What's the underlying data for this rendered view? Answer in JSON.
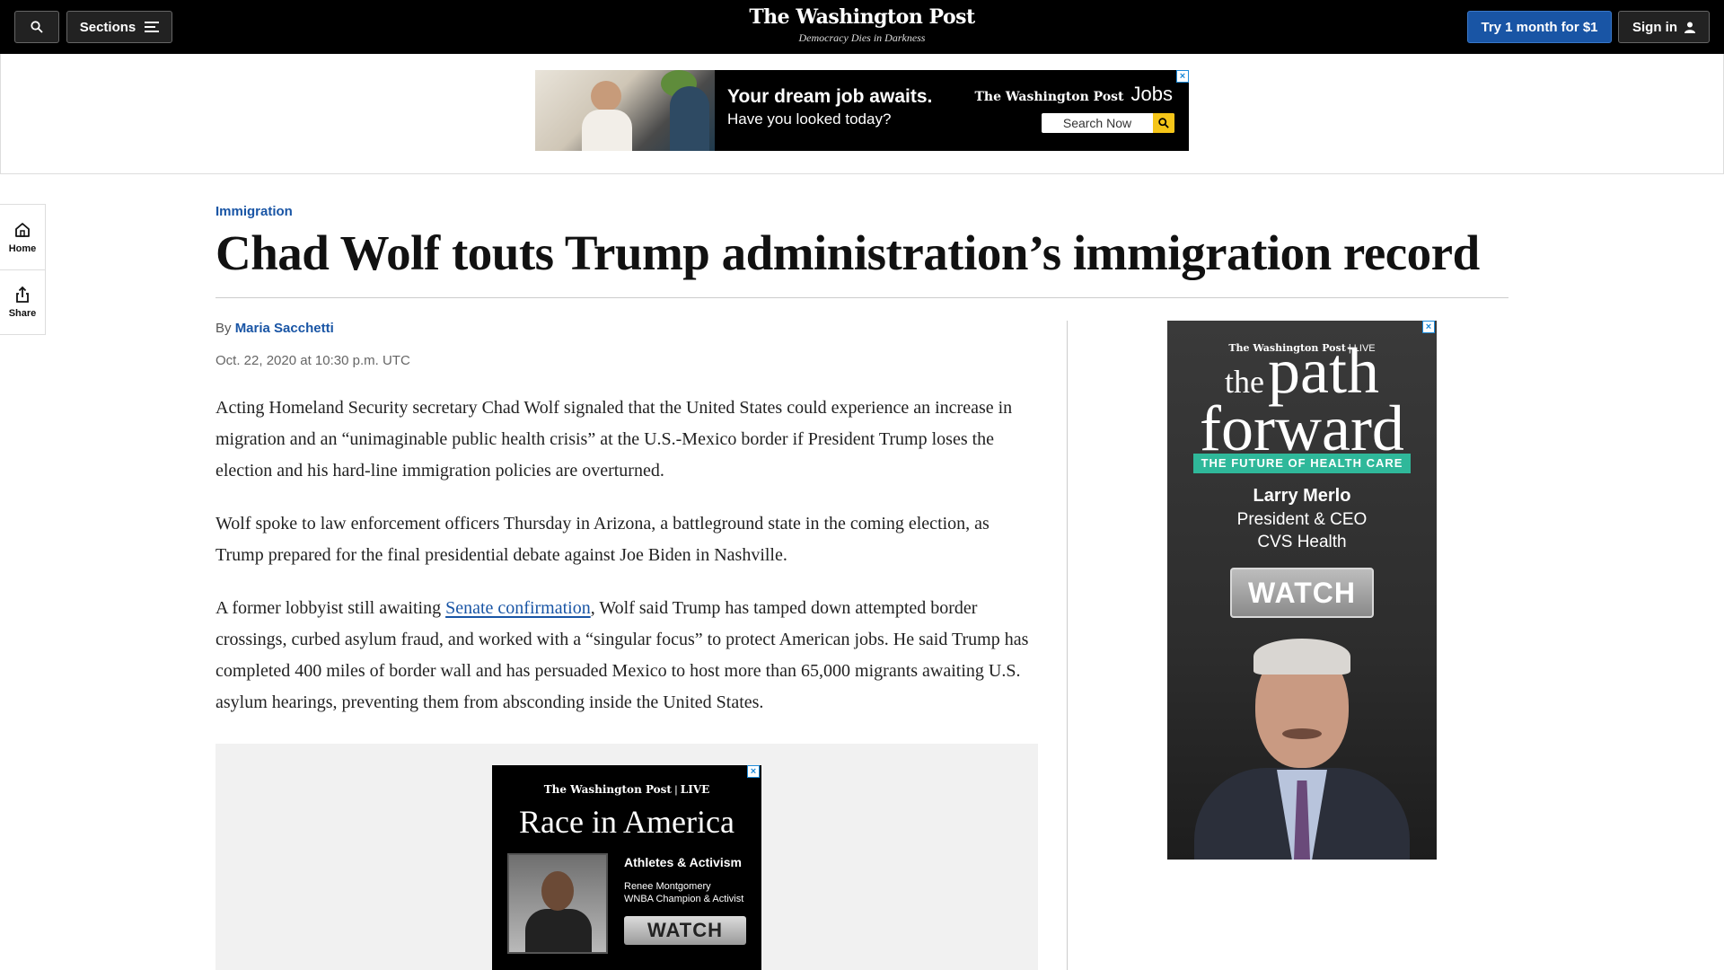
{
  "nav": {
    "sections_label": "Sections",
    "masthead": "The Washington Post",
    "tagline": "Democracy Dies in Darkness",
    "try_label": "Try 1 month for $1",
    "signin_label": "Sign in"
  },
  "top_ad": {
    "headline": "Your dream job awaits.",
    "subline": "Have you looked today?",
    "brand_logo": "The Washington Post",
    "brand_word": "Jobs",
    "search_label": "Search Now"
  },
  "left_rail": {
    "home_label": "Home",
    "share_label": "Share"
  },
  "article": {
    "kicker": "Immigration",
    "headline": "Chad Wolf touts Trump administration’s immigration record",
    "byline_prefix": "By",
    "author": "Maria Sacchetti",
    "dateline": "Oct. 22, 2020 at 10:30 p.m. UTC",
    "p1": "Acting Homeland Security secretary Chad Wolf signaled that the United States could experience an increase in migration and an “unimaginable public health crisis” at the U.S.-Mexico border if President Trump loses the election and his hard-line immigration policies are overturned.",
    "p2": "Wolf spoke to law enforcement officers Thursday in Arizona, a battleground state in the coming election, as Trump prepared for the final presidential debate against Joe Biden in Nashville.",
    "p3_before": "A former lobbyist still awaiting ",
    "p3_link": "Senate confirmation",
    "p3_after": ", Wolf said Trump has tamped down attempted border crossings, curbed asylum fraud, and worked with a “singular focus” to protect American jobs. He said Trump has completed 400 miles of border wall and has persuaded Mexico to host more than 65,000 migrants awaiting U.S. asylum hearings, preventing them from absconding inside the United States."
  },
  "inline_ad": {
    "brand_logo": "The Washington Post",
    "brand_live": "LIVE",
    "title": "Race in America",
    "subtitle": "Athletes & Activism",
    "name": "Renee Montgomery",
    "role": "WNBA Champion & Activist",
    "watch": "WATCH"
  },
  "right_ad": {
    "brand_logo": "The Washington Post",
    "brand_live": "LIVE",
    "title_the": "the",
    "title_path": "path",
    "title_forward": "forward",
    "band": "THE FUTURE OF HEALTH CARE",
    "name": "Larry Merlo",
    "role1": "President & CEO",
    "role2": "CVS Health",
    "watch": "WATCH"
  },
  "colors": {
    "accent_blue": "#1955a5",
    "nav_bg": "#000000",
    "band_teal": "#2fb89a",
    "search_yellow": "#f5c518"
  },
  "icons": [
    "search-icon",
    "menu-icon",
    "user-icon",
    "home-icon",
    "share-icon",
    "adchoices-icon"
  ]
}
